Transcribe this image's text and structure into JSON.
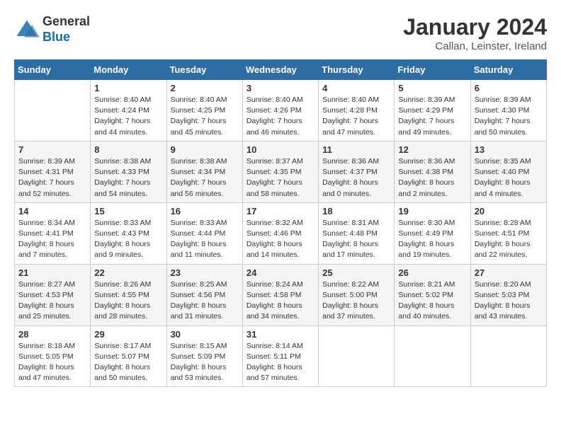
{
  "header": {
    "logo_general": "General",
    "logo_blue": "Blue",
    "month_title": "January 2024",
    "subtitle": "Callan, Leinster, Ireland"
  },
  "days_of_week": [
    "Sunday",
    "Monday",
    "Tuesday",
    "Wednesday",
    "Thursday",
    "Friday",
    "Saturday"
  ],
  "weeks": [
    [
      {
        "day": "",
        "sunrise": "",
        "sunset": "",
        "daylight": ""
      },
      {
        "day": "1",
        "sunrise": "Sunrise: 8:40 AM",
        "sunset": "Sunset: 4:24 PM",
        "daylight": "Daylight: 7 hours and 44 minutes."
      },
      {
        "day": "2",
        "sunrise": "Sunrise: 8:40 AM",
        "sunset": "Sunset: 4:25 PM",
        "daylight": "Daylight: 7 hours and 45 minutes."
      },
      {
        "day": "3",
        "sunrise": "Sunrise: 8:40 AM",
        "sunset": "Sunset: 4:26 PM",
        "daylight": "Daylight: 7 hours and 46 minutes."
      },
      {
        "day": "4",
        "sunrise": "Sunrise: 8:40 AM",
        "sunset": "Sunset: 4:28 PM",
        "daylight": "Daylight: 7 hours and 47 minutes."
      },
      {
        "day": "5",
        "sunrise": "Sunrise: 8:39 AM",
        "sunset": "Sunset: 4:29 PM",
        "daylight": "Daylight: 7 hours and 49 minutes."
      },
      {
        "day": "6",
        "sunrise": "Sunrise: 8:39 AM",
        "sunset": "Sunset: 4:30 PM",
        "daylight": "Daylight: 7 hours and 50 minutes."
      }
    ],
    [
      {
        "day": "7",
        "sunrise": "Sunrise: 8:39 AM",
        "sunset": "Sunset: 4:31 PM",
        "daylight": "Daylight: 7 hours and 52 minutes."
      },
      {
        "day": "8",
        "sunrise": "Sunrise: 8:38 AM",
        "sunset": "Sunset: 4:33 PM",
        "daylight": "Daylight: 7 hours and 54 minutes."
      },
      {
        "day": "9",
        "sunrise": "Sunrise: 8:38 AM",
        "sunset": "Sunset: 4:34 PM",
        "daylight": "Daylight: 7 hours and 56 minutes."
      },
      {
        "day": "10",
        "sunrise": "Sunrise: 8:37 AM",
        "sunset": "Sunset: 4:35 PM",
        "daylight": "Daylight: 7 hours and 58 minutes."
      },
      {
        "day": "11",
        "sunrise": "Sunrise: 8:36 AM",
        "sunset": "Sunset: 4:37 PM",
        "daylight": "Daylight: 8 hours and 0 minutes."
      },
      {
        "day": "12",
        "sunrise": "Sunrise: 8:36 AM",
        "sunset": "Sunset: 4:38 PM",
        "daylight": "Daylight: 8 hours and 2 minutes."
      },
      {
        "day": "13",
        "sunrise": "Sunrise: 8:35 AM",
        "sunset": "Sunset: 4:40 PM",
        "daylight": "Daylight: 8 hours and 4 minutes."
      }
    ],
    [
      {
        "day": "14",
        "sunrise": "Sunrise: 8:34 AM",
        "sunset": "Sunset: 4:41 PM",
        "daylight": "Daylight: 8 hours and 7 minutes."
      },
      {
        "day": "15",
        "sunrise": "Sunrise: 8:33 AM",
        "sunset": "Sunset: 4:43 PM",
        "daylight": "Daylight: 8 hours and 9 minutes."
      },
      {
        "day": "16",
        "sunrise": "Sunrise: 8:33 AM",
        "sunset": "Sunset: 4:44 PM",
        "daylight": "Daylight: 8 hours and 11 minutes."
      },
      {
        "day": "17",
        "sunrise": "Sunrise: 8:32 AM",
        "sunset": "Sunset: 4:46 PM",
        "daylight": "Daylight: 8 hours and 14 minutes."
      },
      {
        "day": "18",
        "sunrise": "Sunrise: 8:31 AM",
        "sunset": "Sunset: 4:48 PM",
        "daylight": "Daylight: 8 hours and 17 minutes."
      },
      {
        "day": "19",
        "sunrise": "Sunrise: 8:30 AM",
        "sunset": "Sunset: 4:49 PM",
        "daylight": "Daylight: 8 hours and 19 minutes."
      },
      {
        "day": "20",
        "sunrise": "Sunrise: 8:28 AM",
        "sunset": "Sunset: 4:51 PM",
        "daylight": "Daylight: 8 hours and 22 minutes."
      }
    ],
    [
      {
        "day": "21",
        "sunrise": "Sunrise: 8:27 AM",
        "sunset": "Sunset: 4:53 PM",
        "daylight": "Daylight: 8 hours and 25 minutes."
      },
      {
        "day": "22",
        "sunrise": "Sunrise: 8:26 AM",
        "sunset": "Sunset: 4:55 PM",
        "daylight": "Daylight: 8 hours and 28 minutes."
      },
      {
        "day": "23",
        "sunrise": "Sunrise: 8:25 AM",
        "sunset": "Sunset: 4:56 PM",
        "daylight": "Daylight: 8 hours and 31 minutes."
      },
      {
        "day": "24",
        "sunrise": "Sunrise: 8:24 AM",
        "sunset": "Sunset: 4:58 PM",
        "daylight": "Daylight: 8 hours and 34 minutes."
      },
      {
        "day": "25",
        "sunrise": "Sunrise: 8:22 AM",
        "sunset": "Sunset: 5:00 PM",
        "daylight": "Daylight: 8 hours and 37 minutes."
      },
      {
        "day": "26",
        "sunrise": "Sunrise: 8:21 AM",
        "sunset": "Sunset: 5:02 PM",
        "daylight": "Daylight: 8 hours and 40 minutes."
      },
      {
        "day": "27",
        "sunrise": "Sunrise: 8:20 AM",
        "sunset": "Sunset: 5:03 PM",
        "daylight": "Daylight: 8 hours and 43 minutes."
      }
    ],
    [
      {
        "day": "28",
        "sunrise": "Sunrise: 8:18 AM",
        "sunset": "Sunset: 5:05 PM",
        "daylight": "Daylight: 8 hours and 47 minutes."
      },
      {
        "day": "29",
        "sunrise": "Sunrise: 8:17 AM",
        "sunset": "Sunset: 5:07 PM",
        "daylight": "Daylight: 8 hours and 50 minutes."
      },
      {
        "day": "30",
        "sunrise": "Sunrise: 8:15 AM",
        "sunset": "Sunset: 5:09 PM",
        "daylight": "Daylight: 8 hours and 53 minutes."
      },
      {
        "day": "31",
        "sunrise": "Sunrise: 8:14 AM",
        "sunset": "Sunset: 5:11 PM",
        "daylight": "Daylight: 8 hours and 57 minutes."
      },
      {
        "day": "",
        "sunrise": "",
        "sunset": "",
        "daylight": ""
      },
      {
        "day": "",
        "sunrise": "",
        "sunset": "",
        "daylight": ""
      },
      {
        "day": "",
        "sunrise": "",
        "sunset": "",
        "daylight": ""
      }
    ]
  ]
}
